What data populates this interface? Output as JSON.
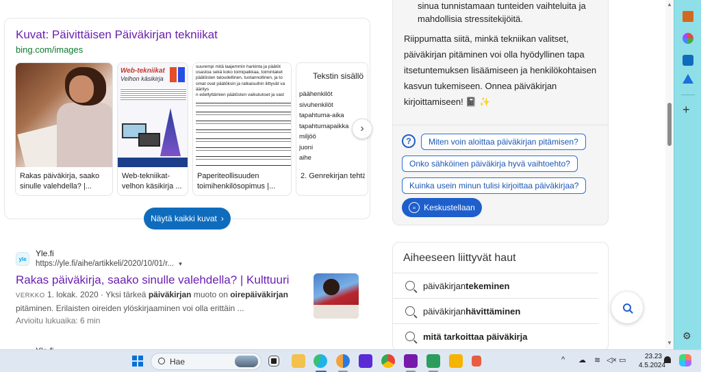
{
  "image_card": {
    "title": "Kuvat: Päivittäisen Päiväkirjan tekniikat",
    "source": "bing.com/images",
    "thumbnails": [
      {
        "caption": "Rakas päiväkirja, saako sinulle valehdella? |..."
      },
      {
        "caption": "Web-tekniikat-velhon käsikirja ...",
        "art_title": "Web-tekniikat",
        "art_sub": "Velhon käsikirja"
      },
      {
        "caption": "Paperiteollisuuden toimihenkilösopimus |...",
        "art_text": "suurempi mitä laajemmin harkinta ja päätöt\nosastoa sekä koko toimipaikkaa, toimintaket\npäätösten taloudellinen, tuotannollinen, ja to\nomat ovat päätöksin ja ratkaisuihin liittyvät va\nääritys\nn edellyttämien päätösten vaikutukset ja vast"
      },
      {
        "caption": "2. Genrekirjan tehtä",
        "art_heading": "Tekstin sisällö",
        "art_list": [
          "päähenkilöt",
          "sivuhenkilöt",
          "tapahtuma-aika",
          "tapahtumapaikka",
          "miljöö",
          "juoni",
          "aihe"
        ]
      }
    ],
    "show_all_label": "Näytä kaikki kuvat",
    "chevron_glyph": "›"
  },
  "result": {
    "favicon_text": "yle",
    "site_name": "Yle.fi",
    "url": "https://yle.fi/aihe/artikkeli/2020/10/01/r...",
    "url_caret": "▾",
    "title": "Rakas päiväkirja, saako sinulle valehdella? | Kulttuuri",
    "badge": "VERKKO",
    "snippet_pre": " 1. lokak. 2020 · Yksi tärkeä ",
    "snippet_b1": "päiväkirjan",
    "snippet_mid": " muoto on ",
    "snippet_b2": "oirepäiväkirjan",
    "snippet_post": " pitäminen. Erilaisten oireiden ylöskirjaaminen voi olla erittäin ...",
    "read_time": "Arvioitu lukuaika: 6 min",
    "next_site_name": "Yle.fi"
  },
  "ai_panel": {
    "bullet_text": "sinua tunnistamaan tunteiden vaihteluita ja mahdollisia stressitekijöitä.",
    "closing_text": "Riippumatta siitä, minkä tekniikan valitset, päiväkirjan pitäminen voi olla hyödyllinen tapa itsetuntemuksen lisäämiseen ja henkilökohtaisen kasvun tukemiseen. Onnea päiväkirjan kirjoittamiseen! 📓 ✨",
    "suggestions": [
      "Miten voin aloittaa päiväkirjan pitämisen?",
      "Onko sähköinen päiväkirja hyvä vaihtoehto?",
      "Kuinka usein minun tulisi kirjoittaa päiväkirjaa?"
    ],
    "chat_label": "Keskustellaan"
  },
  "related": {
    "title": "Aiheeseen liittyvät haut",
    "items": [
      {
        "prefix": "päiväkirjan ",
        "bold": "tekeminen"
      },
      {
        "prefix": "päiväkirjan ",
        "bold": "hävittäminen"
      },
      {
        "prefix": "",
        "bold": "mitä tarkoittaa päiväkirja"
      }
    ]
  },
  "scrollbar": {
    "up_glyph": "▲",
    "down_glyph": "▼"
  },
  "sidebar": {
    "plus_glyph": "+",
    "gear_glyph": "⚙"
  },
  "taskbar": {
    "search_placeholder": "Hae",
    "tray": {
      "chevron": "^",
      "cloud": "☁",
      "wifi": "≋",
      "volume": "◁×",
      "battery": "▭"
    },
    "time": "23.23",
    "date": "4.5.2024"
  }
}
